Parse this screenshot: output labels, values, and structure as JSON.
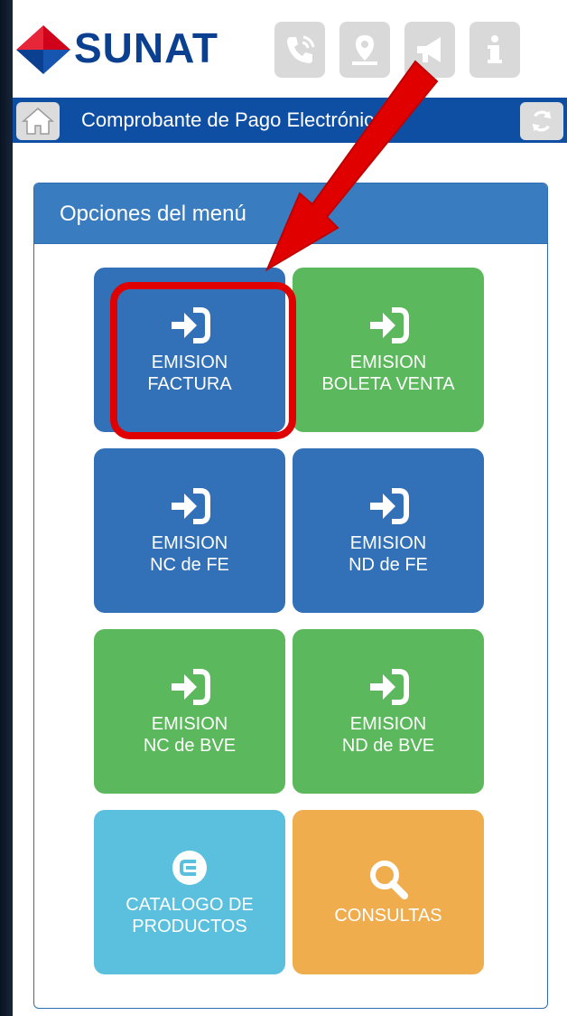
{
  "header": {
    "brand": "SUNAT",
    "toolbar_icons": [
      "phone-icon",
      "location-pin-icon",
      "megaphone-icon",
      "info-icon"
    ]
  },
  "titlebar": {
    "title": "Comprobante de Pago Electrónico"
  },
  "menu": {
    "title": "Opciones del menú",
    "tiles": [
      {
        "line1": "EMISION",
        "line2": "FACTURA",
        "color": "#3271b8",
        "icon": "sign-in-icon"
      },
      {
        "line1": "EMISION",
        "line2": "BOLETA VENTA",
        "color": "#5cb85c",
        "icon": "sign-in-icon"
      },
      {
        "line1": "EMISION",
        "line2": "NC de FE",
        "color": "#3271b8",
        "icon": "sign-in-icon"
      },
      {
        "line1": "EMISION",
        "line2": "ND de FE",
        "color": "#3271b8",
        "icon": "sign-in-icon"
      },
      {
        "line1": "EMISION",
        "line2": "NC de BVE",
        "color": "#5cb85c",
        "icon": "sign-in-icon"
      },
      {
        "line1": "EMISION",
        "line2": "ND de BVE",
        "color": "#5cb85c",
        "icon": "sign-in-icon"
      },
      {
        "line1": "CATALOGO DE",
        "line2": "PRODUCTOS",
        "color": "#5bc0de",
        "icon": "catalog-icon"
      },
      {
        "line1": "CONSULTAS",
        "line2": "",
        "color": "#f0ad4e",
        "icon": "search-icon"
      }
    ]
  },
  "colors": {
    "brand_blue": "#0f4fa3",
    "panel_header": "#3a7cc0",
    "annotation_red": "#e00000"
  }
}
